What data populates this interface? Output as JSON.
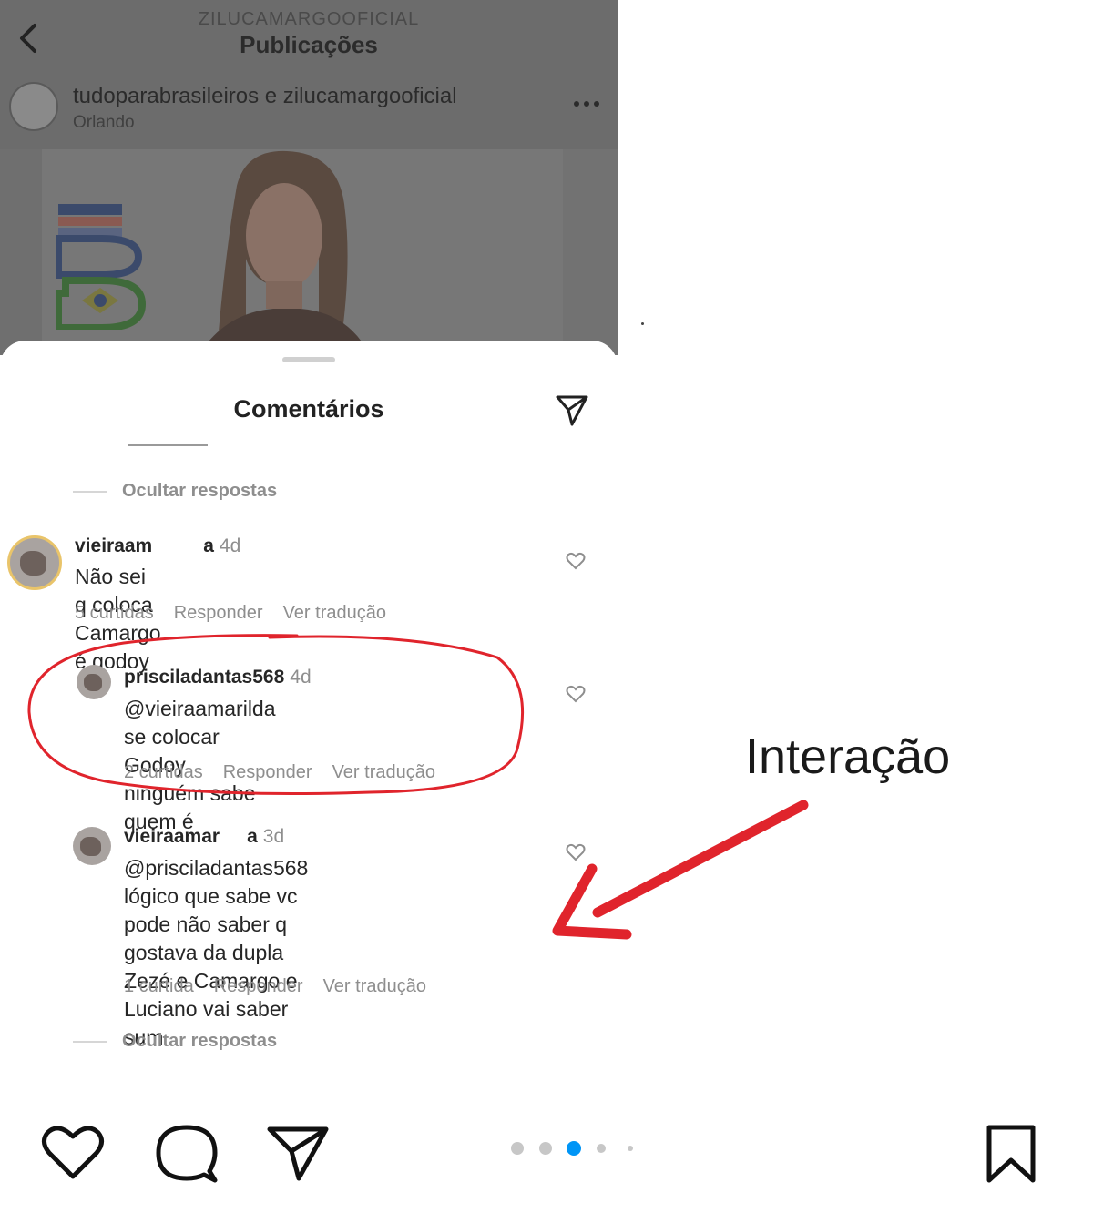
{
  "header": {
    "username": "ZILUCAMARGOOFICIAL",
    "title": "Publicações"
  },
  "post": {
    "authors": "tudoparabrasileiros e zilucamargooficial",
    "location": "Orlando"
  },
  "sheet": {
    "title": "Comentários"
  },
  "hide_replies_label": "Ocultar respostas",
  "comments": [
    {
      "username": "vieiraam",
      "username_tail": "a",
      "time": "4d",
      "text": "Não sei q coloca Camargo é godoy",
      "likes": "5 curtidas",
      "reply": "Responder",
      "translate": "Ver tradução"
    },
    {
      "username": "prisciladantas568",
      "time": "4d",
      "text_line1": "@vieiraamarilda se colocar Godoy",
      "text_line2": "ninguém sabe quem é",
      "likes": "2 curtidas",
      "reply": "Responder",
      "translate": "Ver tradução"
    },
    {
      "username": "vieiraamar",
      "username_tail": "a",
      "time": "3d",
      "text_line1": "@prisciladantas568 lógico que sabe vc",
      "text_line2": "pode não saber  q  gostava da dupla",
      "text_line3": "Zezé e Camargo e Luciano vai saber",
      "text_line4": "sum",
      "likes": "1 curtida",
      "reply": "Responder",
      "translate": "Ver tradução"
    }
  ],
  "annotation": {
    "label": "Interação",
    "color": "#e0242c"
  },
  "pager": {
    "count": 5,
    "active_index": 2,
    "active_color": "#0095f6"
  },
  "icons": {
    "back": "chevron-left-icon",
    "more": "more-horizontal-icon",
    "send": "paper-plane-icon",
    "like": "heart-icon",
    "comment": "speech-bubble-icon",
    "save": "bookmark-icon"
  }
}
